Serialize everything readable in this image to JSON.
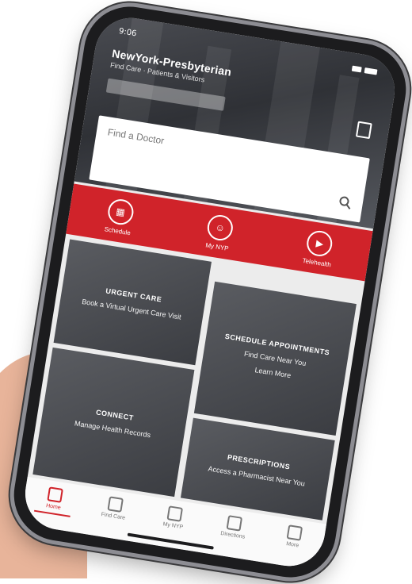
{
  "status": {
    "time": "9:06"
  },
  "header": {
    "title": "NewYork-Presbyterian",
    "subtitle": "Find Care · Patients & Visitors"
  },
  "search": {
    "placeholder": "Find a Doctor"
  },
  "quick_actions": [
    {
      "label": "Schedule",
      "icon": "calendar-icon"
    },
    {
      "label": "My NYP",
      "icon": "person-icon"
    },
    {
      "label": "Telehealth",
      "icon": "video-icon"
    }
  ],
  "tiles": [
    {
      "heading": "URGENT CARE",
      "body": "Book a Virtual Urgent Care Visit"
    },
    {
      "heading": "SCHEDULE APPOINTMENTS",
      "body": "Find Care Near You",
      "extra": "Learn More"
    },
    {
      "heading": "CONNECT",
      "body": "Manage Health Records"
    },
    {
      "heading": "PRESCRIPTIONS",
      "body": "Access a Pharmacist Near You"
    }
  ],
  "tabs": [
    {
      "label": "Home",
      "active": true
    },
    {
      "label": "Find Care",
      "active": false
    },
    {
      "label": "My NYP",
      "active": false
    },
    {
      "label": "Directions",
      "active": false
    },
    {
      "label": "More",
      "active": false
    }
  ],
  "colors": {
    "brand_red": "#d0232a",
    "hero_dark": "#2f3136",
    "tile_dark": "#3b3d42"
  }
}
